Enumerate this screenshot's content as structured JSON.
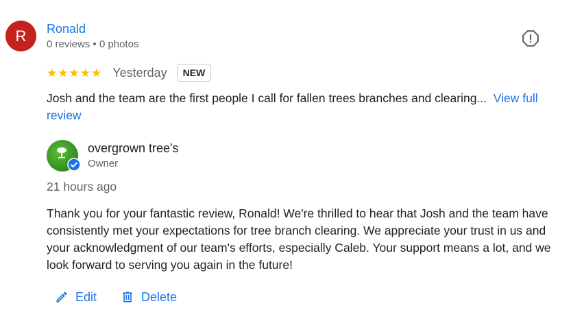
{
  "review": {
    "avatar_letter": "R",
    "avatar_color": "#c5221f",
    "reviewer_name": "Ronald",
    "reviewer_meta": "0 reviews • 0 photos",
    "rating": 5,
    "date": "Yesterday",
    "badge": "NEW",
    "text": "Josh and the team are the first people I call for fallen trees branches and clearing...",
    "more_link": "View full review",
    "report_icon": "report-flag-icon"
  },
  "reply": {
    "owner_name": "overgrown tree's",
    "owner_role": "Owner",
    "time": "21 hours ago",
    "text": "Thank you for your fantastic review, Ronald! We're thrilled to hear that Josh and the team have consistently met your expectations for tree branch clearing. We appreciate your trust in us and your acknowledgment of our team's efforts, especially Caleb. Your support means a lot, and we look forward to serving you again in the future!",
    "verified_color": "#1a73e8"
  },
  "actions": {
    "edit_label": "Edit",
    "delete_label": "Delete"
  },
  "colors": {
    "link": "#1a73e8",
    "star": "#fbbc04",
    "secondary_text": "#5f6368"
  }
}
